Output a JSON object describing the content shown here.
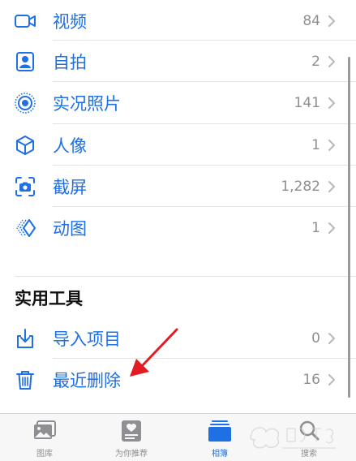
{
  "colors": {
    "accent": "#1f6fe5",
    "count_gray": "#8e8e93",
    "section_title": "#111111",
    "arrow_red": "#e31b23"
  },
  "media_types": [
    {
      "label": "视频",
      "count": "84",
      "icon": "video-icon"
    },
    {
      "label": "自拍",
      "count": "2",
      "icon": "selfie-icon"
    },
    {
      "label": "实况照片",
      "count": "141",
      "icon": "live-photo-icon"
    },
    {
      "label": "人像",
      "count": "1",
      "icon": "portrait-cube-icon"
    },
    {
      "label": "截屏",
      "count": "1,282",
      "icon": "screenshot-icon"
    },
    {
      "label": "动图",
      "count": "1",
      "icon": "animated-icon"
    }
  ],
  "utilities": {
    "title": "实用工具",
    "items": [
      {
        "label": "导入项目",
        "count": "0",
        "icon": "import-icon"
      },
      {
        "label": "最近删除",
        "count": "16",
        "icon": "trash-icon"
      }
    ]
  },
  "tabbar": {
    "items": [
      {
        "label": "图库",
        "icon": "photos-library-icon",
        "active": false
      },
      {
        "label": "为你推荐",
        "icon": "for-you-icon",
        "active": false
      },
      {
        "label": "相簿",
        "icon": "albums-icon",
        "active": true
      },
      {
        "label": "搜索",
        "icon": "search-icon",
        "active": false
      }
    ]
  }
}
